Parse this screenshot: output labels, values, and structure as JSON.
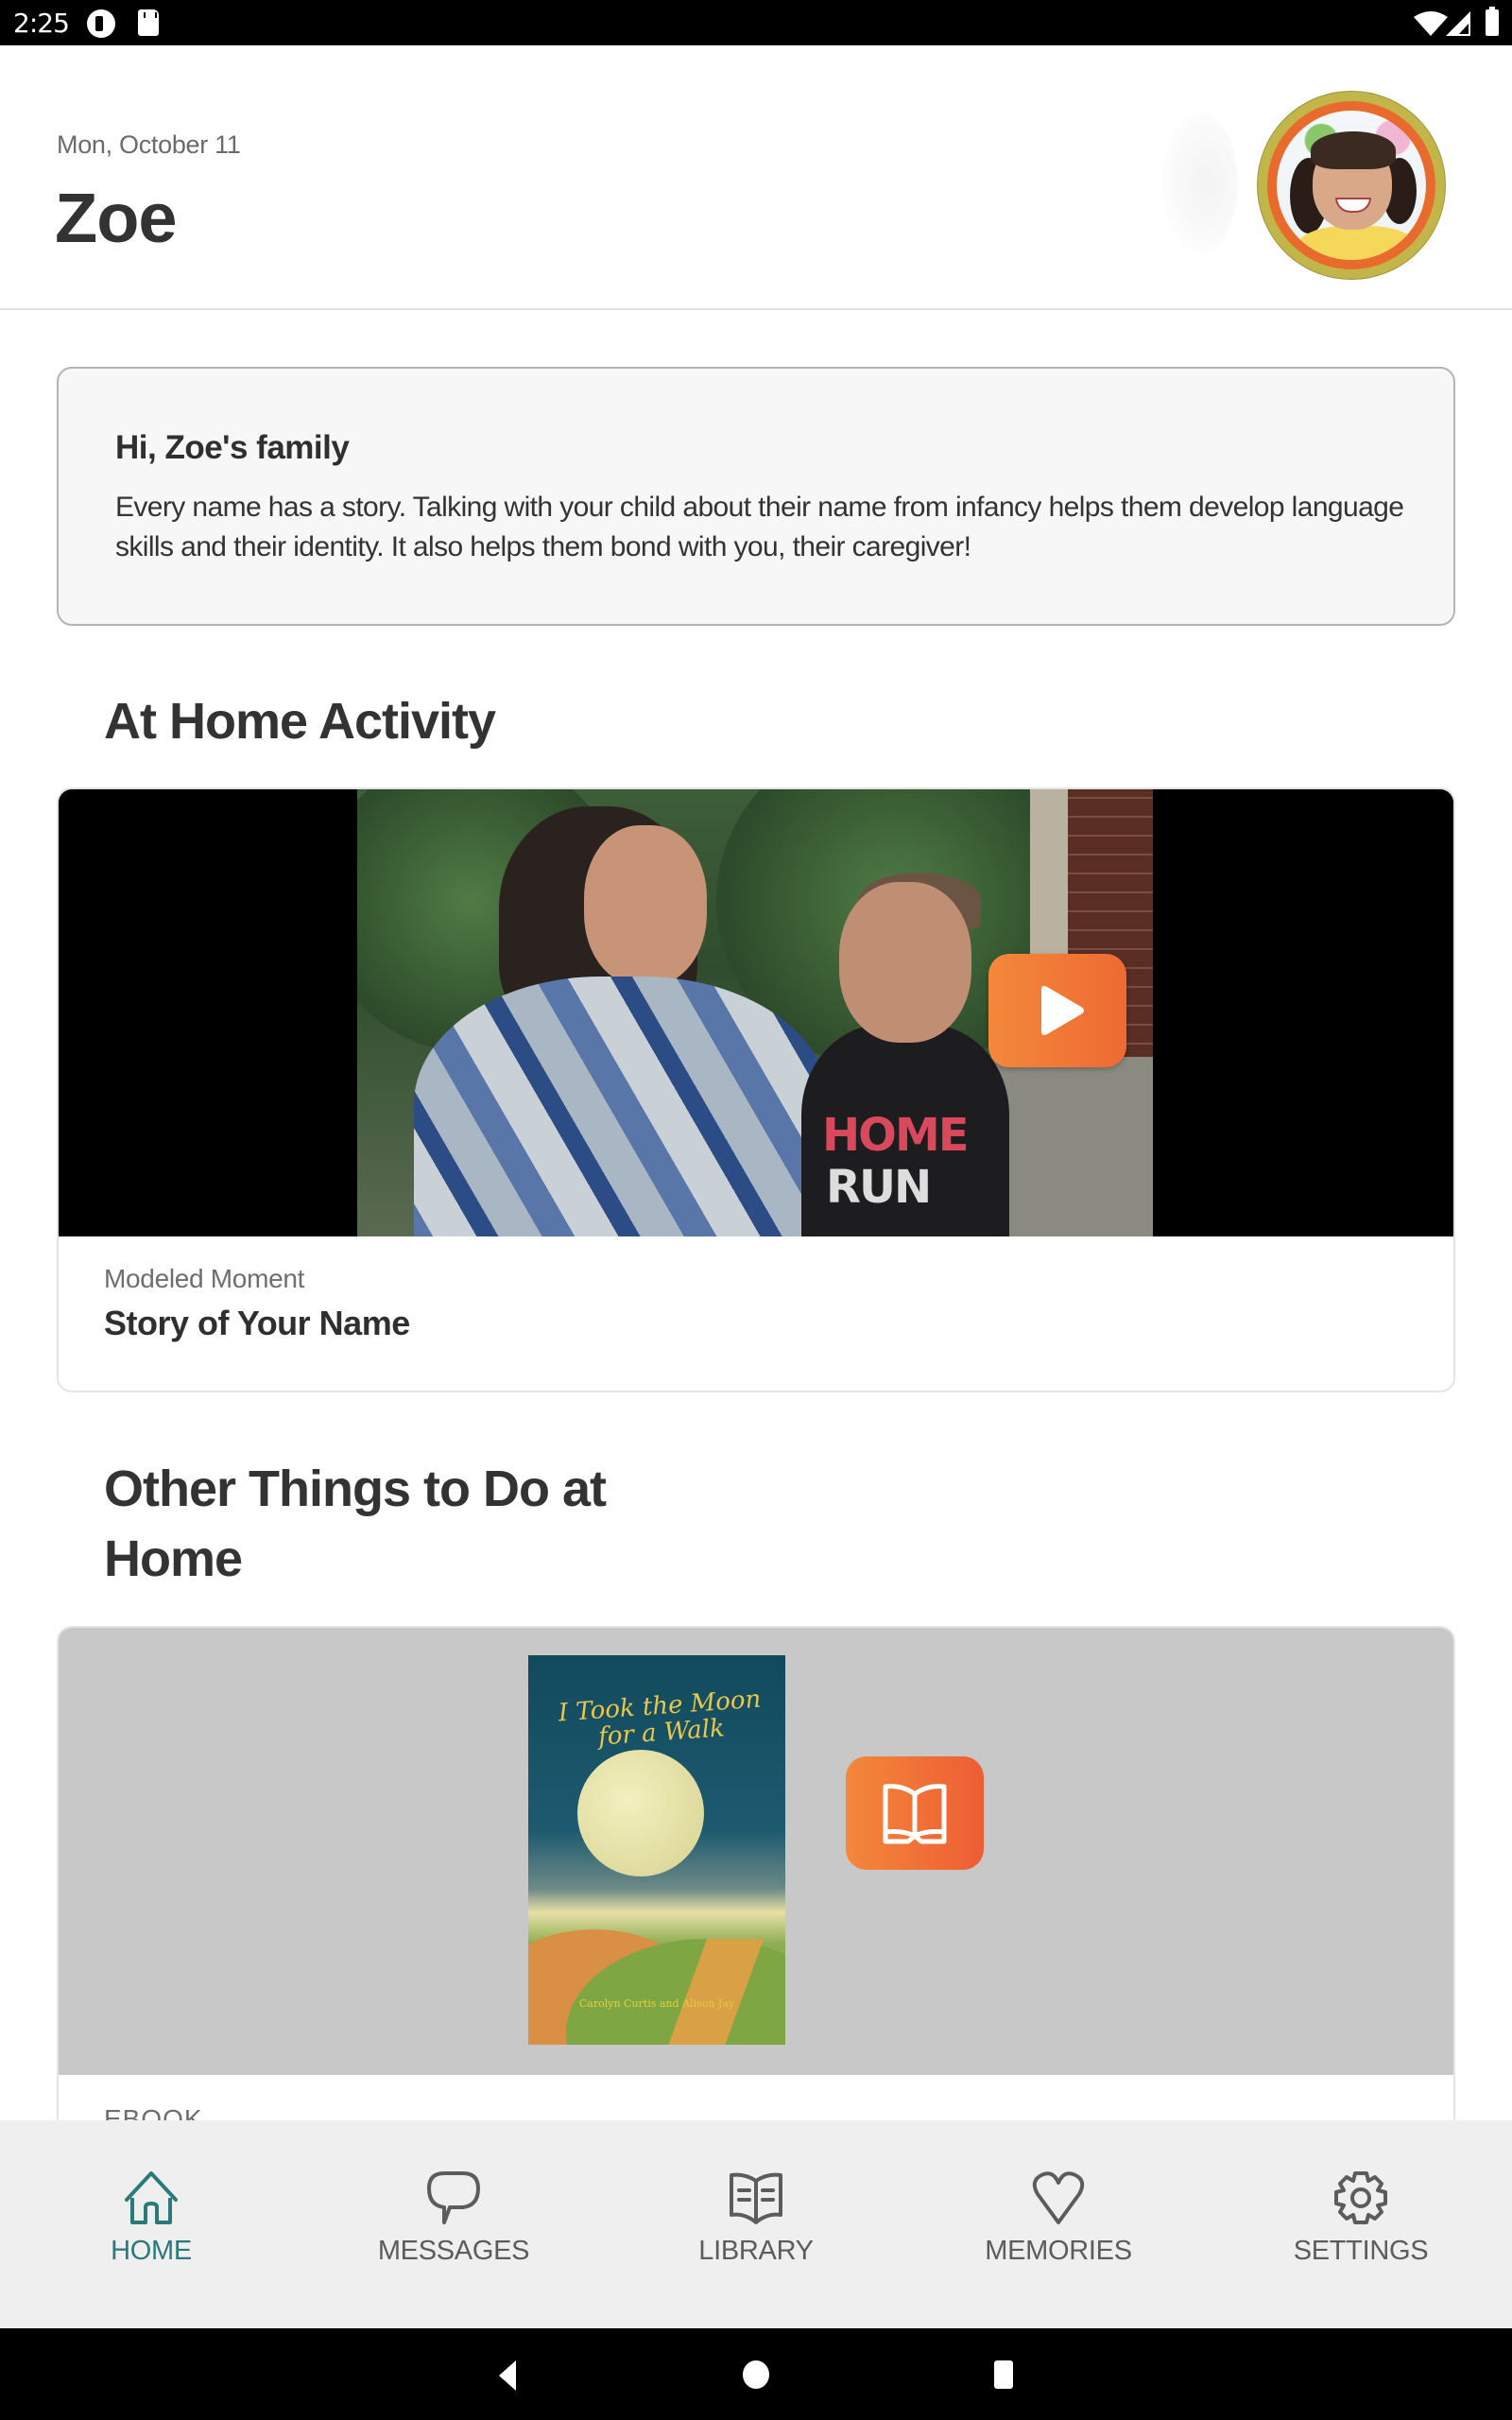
{
  "status_bar": {
    "time": "2:25",
    "left_icons": [
      "app-notification-icon",
      "sd-card-icon"
    ],
    "right_icons": [
      "wifi-icon",
      "cell-signal-icon",
      "battery-icon"
    ]
  },
  "header": {
    "date": "Mon, October 11",
    "child_name": "Zoe",
    "avatar_alt": "Zoe profile photo",
    "avatar_ring_colors": [
      "#c2b54a",
      "#e86a2c"
    ]
  },
  "greeting": {
    "title": "Hi, Zoe's family",
    "body": "Every name has a story. Talking with your child about their name from infancy helps them develop language skills and their identity. It also helps them bond with you, their caregiver!"
  },
  "at_home_activity": {
    "heading": "At Home Activity",
    "video": {
      "category": "Modeled Moment",
      "title": "Story of Your Name",
      "play_icon": "play-icon",
      "shirt_text_line1": "HOME",
      "shirt_text_line2": "RUN"
    }
  },
  "other_things": {
    "heading": "Other Things to Do at Home",
    "items": [
      {
        "category": "EBOOK",
        "cover_title": "I Took the Moon for a Walk",
        "cover_authors": "Carolyn Curtis and Alison Jay",
        "action_icon": "open-book-icon"
      }
    ]
  },
  "bottom_nav": {
    "active": "HOME",
    "items": [
      {
        "label": "HOME",
        "icon": "home-icon"
      },
      {
        "label": "MESSAGES",
        "icon": "chat-bubble-icon"
      },
      {
        "label": "LIBRARY",
        "icon": "book-icon"
      },
      {
        "label": "MEMORIES",
        "icon": "heart-icon"
      },
      {
        "label": "SETTINGS",
        "icon": "gear-icon"
      }
    ]
  },
  "colors": {
    "accent_teal": "#2a7a7a",
    "accent_orange": "#ee6a33",
    "text_primary": "#333333",
    "text_secondary": "#6e6e6e",
    "nav_background": "#efefef"
  }
}
